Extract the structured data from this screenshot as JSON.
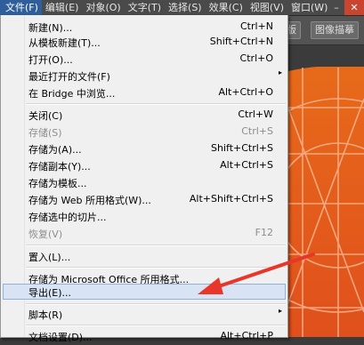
{
  "menubar": {
    "items": [
      {
        "label": "文件(F)"
      },
      {
        "label": "编辑(E)"
      },
      {
        "label": "对象(O)"
      },
      {
        "label": "文字(T)"
      },
      {
        "label": "选择(S)"
      },
      {
        "label": "效果(C)"
      },
      {
        "label": "视图(V)"
      },
      {
        "label": "窗口(W)"
      }
    ],
    "window_controls": {
      "minimize": "–",
      "close": "✕"
    }
  },
  "toolbar": {
    "buttons": [
      {
        "label": "图像描摹"
      },
      {
        "label": "蒙版"
      }
    ]
  },
  "file_menu": {
    "items": [
      {
        "label": "新建(N)...",
        "shortcut": "Ctrl+N"
      },
      {
        "label": "从模板新建(T)...",
        "shortcut": "Shift+Ctrl+N"
      },
      {
        "label": "打开(O)...",
        "shortcut": "Ctrl+O"
      },
      {
        "label": "最近打开的文件(F)",
        "shortcut": ""
      },
      {
        "label": "在 Bridge 中浏览...",
        "shortcut": "Alt+Ctrl+O"
      },
      {
        "label": "关闭(C)",
        "shortcut": "Ctrl+W"
      },
      {
        "label": "存储(S)",
        "shortcut": "Ctrl+S"
      },
      {
        "label": "存储为(A)...",
        "shortcut": "Shift+Ctrl+S"
      },
      {
        "label": "存储副本(Y)...",
        "shortcut": "Alt+Ctrl+S"
      },
      {
        "label": "存储为模板...",
        "shortcut": ""
      },
      {
        "label": "存储为 Web 所用格式(W)...",
        "shortcut": "Alt+Shift+Ctrl+S"
      },
      {
        "label": "存储选中的切片...",
        "shortcut": ""
      },
      {
        "label": "恢复(V)",
        "shortcut": "F12"
      },
      {
        "label": "置入(L)...",
        "shortcut": ""
      },
      {
        "label": "存储为 Microsoft Office 所用格式...",
        "shortcut": ""
      },
      {
        "label": "导出(E)...",
        "shortcut": ""
      },
      {
        "label": "脚本(R)",
        "shortcut": ""
      },
      {
        "label": "文档设置(D)...",
        "shortcut": "Alt+Ctrl+P"
      }
    ],
    "submenu_arrow": "▸"
  },
  "colors": {
    "highlight_bg": "#d8e4f3",
    "menu_bg": "#f0f0f0",
    "annotation_arrow": "#e8362a",
    "art_orange": "#e8651a"
  }
}
